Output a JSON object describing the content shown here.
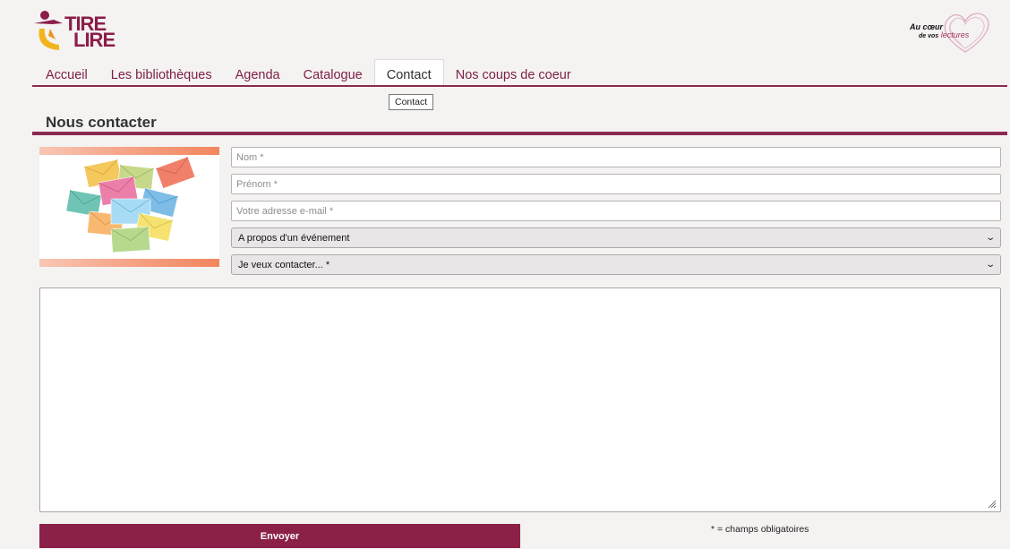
{
  "header": {
    "logo_line1": "TIRE",
    "logo_line2": "LIRE",
    "brand_au_coeur": "Au cœur",
    "brand_de_vos": "de vos",
    "brand_lectures": "lectures"
  },
  "nav": {
    "items": [
      {
        "label": "Accueil"
      },
      {
        "label": "Les bibliothèques"
      },
      {
        "label": "Agenda"
      },
      {
        "label": "Catalogue"
      },
      {
        "label": "Contact"
      },
      {
        "label": "Nos coups de coeur"
      }
    ],
    "active_index": 4,
    "tooltip": "Contact"
  },
  "page": {
    "title": "Nous contacter"
  },
  "form": {
    "nom_placeholder": "Nom *",
    "prenom_placeholder": "Prénom *",
    "email_placeholder": "Votre adresse e-mail *",
    "subject_selected": "A propos d'un événement",
    "recipient_selected": "Je veux contacter... *",
    "message_value": "",
    "submit_label": "Envoyer",
    "required_note": "* = champs obligatoires"
  },
  "colors": {
    "accent": "#8b2149",
    "nav_link": "#7b1f45",
    "background": "#f5f2f2"
  }
}
